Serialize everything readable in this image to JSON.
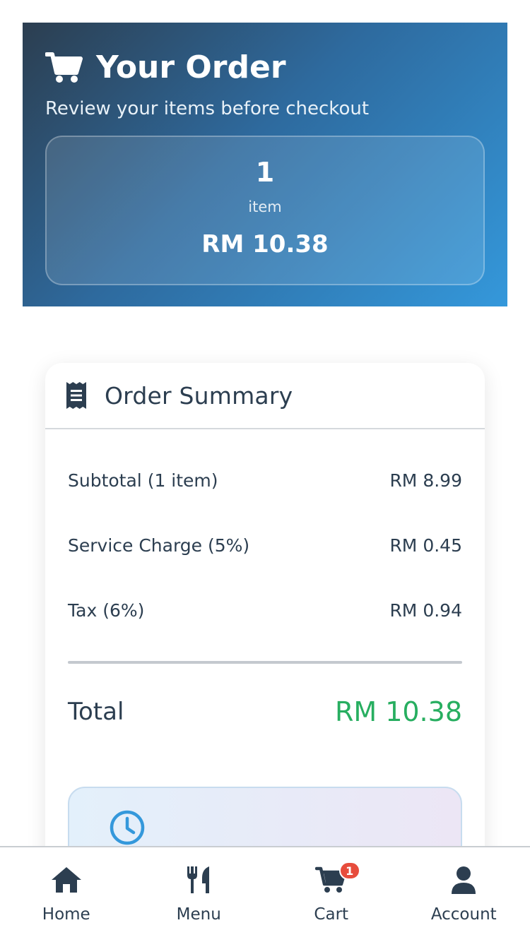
{
  "hero": {
    "title": "Your Order",
    "subtitle": "Review your items before checkout",
    "item_count": "1",
    "item_unit": "item",
    "total": "RM 10.38"
  },
  "summary": {
    "title": "Order Summary",
    "rows": [
      {
        "label": "Subtotal (1 item)",
        "amount": "RM 8.99"
      },
      {
        "label": "Service Charge (5%)",
        "amount": "RM 0.45"
      },
      {
        "label": "Tax (6%)",
        "amount": "RM 0.94"
      }
    ],
    "total_label": "Total",
    "total_value": "RM 10.38"
  },
  "nav": {
    "items": [
      {
        "label": "Home",
        "icon": "home-icon"
      },
      {
        "label": "Menu",
        "icon": "utensils-icon"
      },
      {
        "label": "Cart",
        "icon": "cart-icon",
        "badge": "1"
      },
      {
        "label": "Account",
        "icon": "user-icon"
      }
    ]
  },
  "colors": {
    "primary_dark": "#2c3e50",
    "accent_blue": "#3498db",
    "total_green": "#27ae60",
    "badge_red": "#e74c3c"
  }
}
